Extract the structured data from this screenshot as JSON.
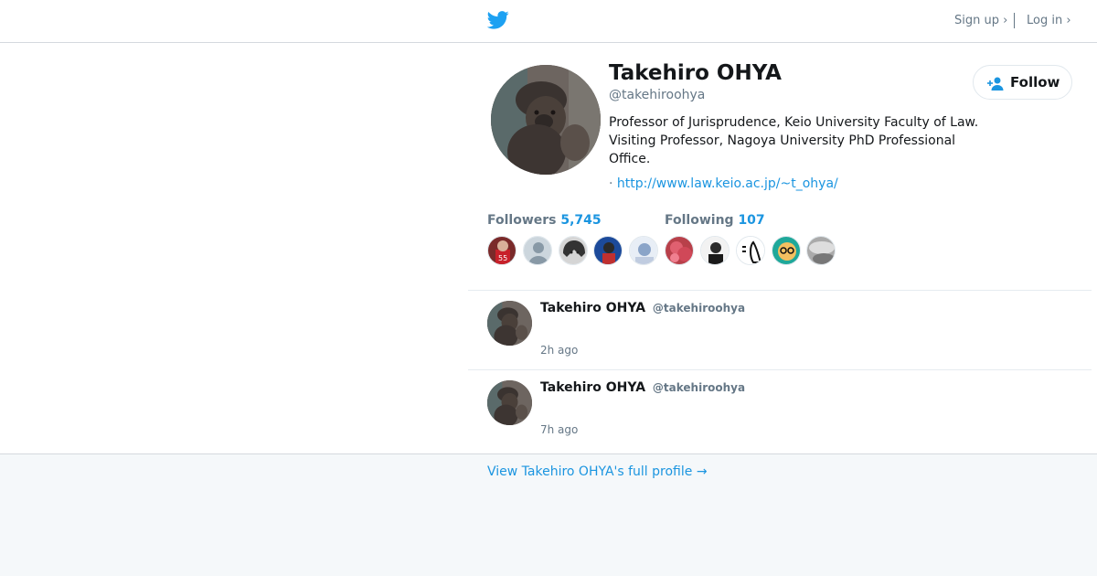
{
  "header": {
    "logo_icon": "twitter-bird-icon",
    "brand_color": "#1da1f2",
    "signup_label": "Sign up ›",
    "login_label": "Log in ›"
  },
  "profile": {
    "name": "Takehiro OHYA",
    "handle": "@takehiroohya",
    "bio": "Professor of Jurisprudence, Keio University Faculty of Law. Visiting Professor, Nagoya University PhD Professional Office.",
    "url_prefix": "·",
    "url": "http://www.law.keio.ac.jp/~t_ohya/",
    "follow_label": "Follow",
    "follow_icon": "add-user-icon"
  },
  "stats": {
    "followers_label": "Followers",
    "followers_count": "5,745",
    "following_label": "Following",
    "following_count": "107"
  },
  "tweets": [
    {
      "name": "Takehiro OHYA",
      "handle": "@takehiroohya",
      "time": "2h ago"
    },
    {
      "name": "Takehiro OHYA",
      "handle": "@takehiroohya",
      "time": "7h ago"
    }
  ],
  "footer": {
    "full_profile_link": "View Takehiro OHYA's full profile →"
  },
  "colors": {
    "link": "#1b95e0",
    "secondary_text": "#657786",
    "footer_bg": "#f5f8fa"
  }
}
